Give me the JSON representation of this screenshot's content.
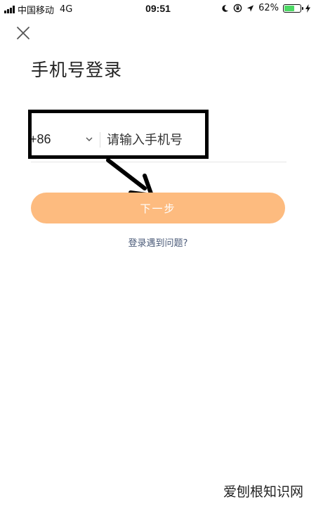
{
  "status_bar": {
    "carrier": "中国移动",
    "network": "4G",
    "time": "09:51",
    "battery_percent": "62%",
    "battery_level": 0.62,
    "battery_color": "#4cd964",
    "icons": [
      "signal-bars",
      "moon-icon",
      "orientation-lock-icon",
      "location-icon",
      "battery-icon",
      "charging-bolt-icon"
    ]
  },
  "header": {
    "close_icon": "close-x",
    "title": "手机号登录"
  },
  "phone": {
    "country_code": "+86",
    "placeholder": "请输入手机号"
  },
  "next_button": {
    "label": "下一步",
    "color": "#fdbb7f"
  },
  "help_link": "登录遇到问题?",
  "watermark": "爱刨根知识网"
}
